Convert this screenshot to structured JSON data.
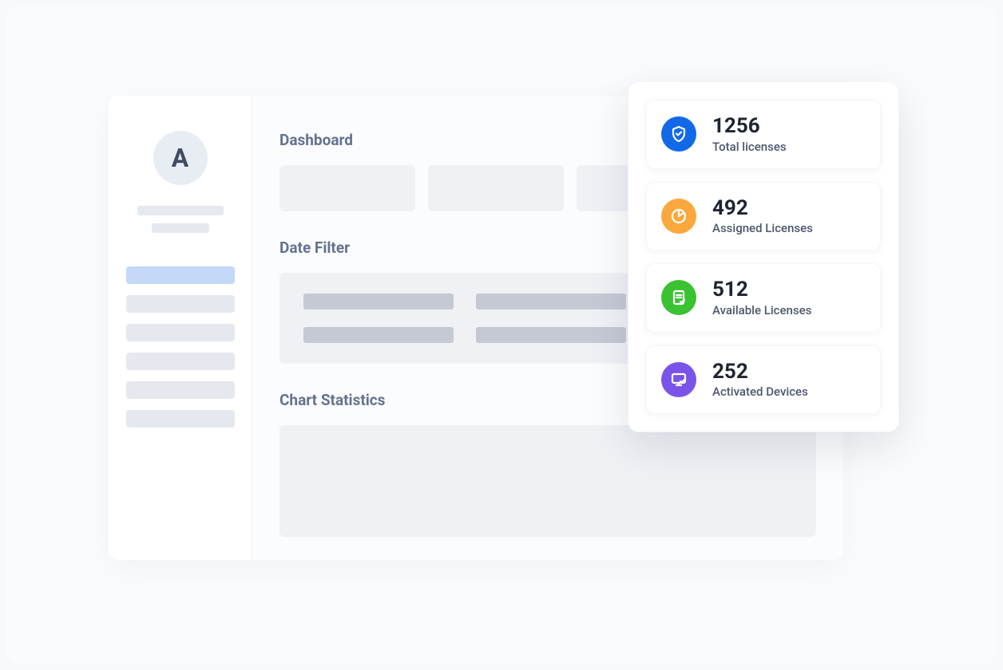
{
  "sidebar": {
    "avatar_letter": "A"
  },
  "main": {
    "dashboard_title": "Dashboard",
    "date_filter_title": "Date Filter",
    "chart_statistics_title": "Chart Statistics"
  },
  "stats": [
    {
      "value": "1256",
      "label": "Total licenses",
      "icon": "shield-check",
      "color": "blue"
    },
    {
      "value": "492",
      "label": "Assigned Licenses",
      "icon": "pie-chart",
      "color": "orange"
    },
    {
      "value": "512",
      "label": "Available Licenses",
      "icon": "document-check",
      "color": "green"
    },
    {
      "value": "252",
      "label": "Activated Devices",
      "icon": "monitor-check",
      "color": "purple"
    }
  ]
}
